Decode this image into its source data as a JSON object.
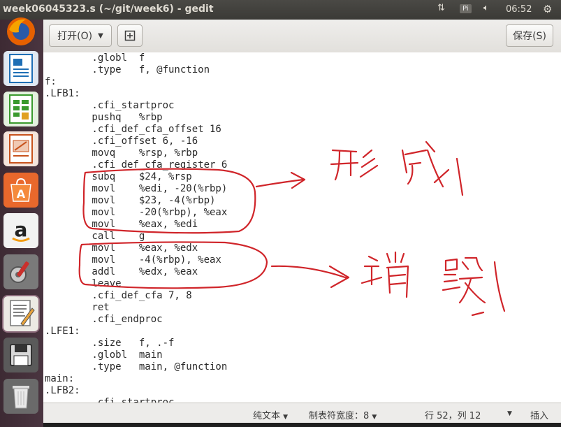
{
  "window": {
    "title": "week06045323.s (~/git/week6) - gedit",
    "tray": {
      "input_method": "Pi",
      "time": "06:52"
    }
  },
  "launcher": {
    "items": [
      {
        "name": "firefox-icon",
        "color": "#e66000"
      },
      {
        "name": "writer-icon",
        "color": "#1f6fb5"
      },
      {
        "name": "calc-icon",
        "color": "#3a9a2e"
      },
      {
        "name": "impress-icon",
        "color": "#c8531d"
      },
      {
        "name": "software-center-icon",
        "color": "#e8682c"
      },
      {
        "name": "amazon-icon",
        "color": "#f2f2f2"
      },
      {
        "name": "system-settings-icon",
        "color": "#c9302c"
      },
      {
        "name": "gedit-icon",
        "color": "#eceae4"
      },
      {
        "name": "save-drive-icon",
        "color": "#3a3a3a"
      },
      {
        "name": "trash-icon",
        "color": "#9b9b9b"
      }
    ]
  },
  "toolbar": {
    "open_label": "打开(O)",
    "save_label": "保存(S)"
  },
  "editor": {
    "lines": [
      "        .globl  f",
      "        .type   f, @function",
      "f:",
      ".LFB1:",
      "        .cfi_startproc",
      "        pushq   %rbp",
      "        .cfi_def_cfa_offset 16",
      "        .cfi_offset 6, -16",
      "        movq    %rsp, %rbp",
      "        .cfi_def_cfa_register 6",
      "        subq    $24, %rsp",
      "        movl    %edi, -20(%rbp)",
      "        movl    $23, -4(%rbp)",
      "        movl    -20(%rbp), %eax",
      "        movl    %eax, %edi",
      "        call    g",
      "        movl    %eax, %edx",
      "        movl    -4(%rbp), %eax",
      "        addl    %edx, %eax",
      "        leave",
      "        .cfi_def_cfa 7, 8",
      "        ret",
      "        .cfi_endproc",
      ".LFE1:",
      "        .size   f, .-f",
      "        .globl  main",
      "        .type   main, @function",
      "main:",
      ".LFB2:",
      "        .cfi_startproc"
    ],
    "annotation_color": "#d0252a",
    "annotations": {
      "top": "形成",
      "bottom": "销毁"
    }
  },
  "statusbar": {
    "syntax": "纯文本",
    "tab_width": "制表符宽度：8",
    "position": "行 52，列 12",
    "mode": "插入"
  }
}
